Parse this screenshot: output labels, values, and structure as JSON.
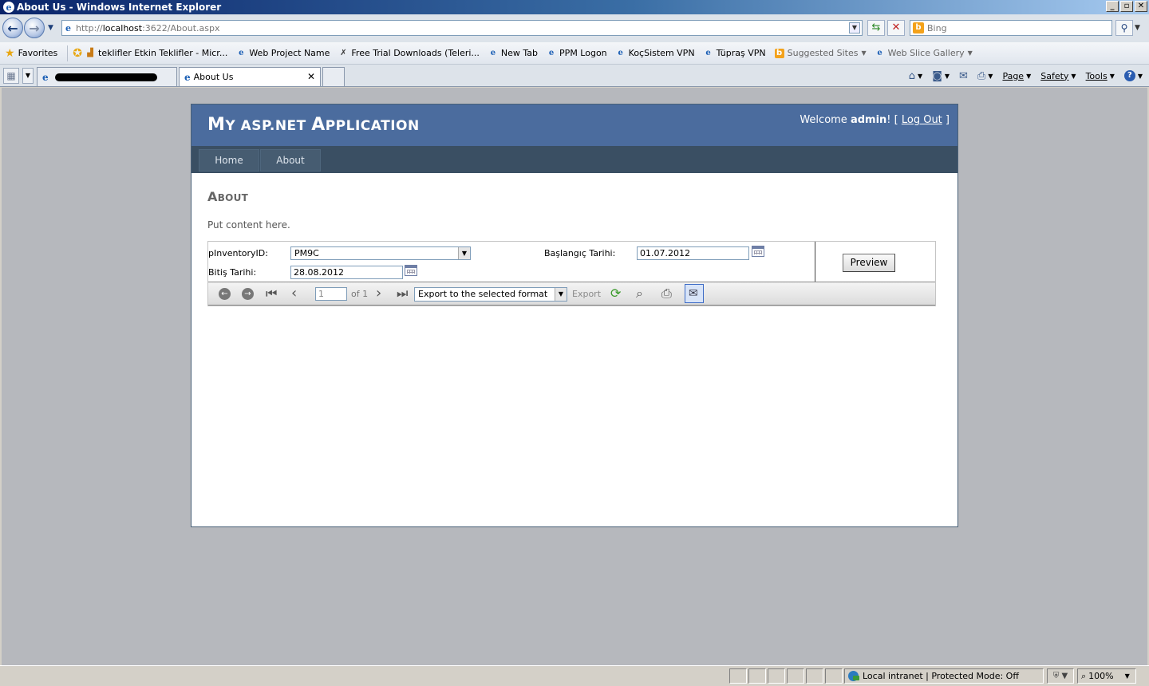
{
  "window": {
    "title": "About Us - Windows Internet Explorer",
    "minimize": "_",
    "maximize": "▫",
    "close": "✕"
  },
  "address": {
    "url_prefix": "http://",
    "url_host": "localhost",
    "url_rest": ":3622/About.aspx",
    "search_placeholder": "Bing"
  },
  "favorites": {
    "label": "Favorites",
    "items": [
      {
        "label": "teklifler Etkin Teklifler - Micr...",
        "icon": "chart-icon"
      },
      {
        "label": "Web Project Name",
        "icon": "ie-page-icon"
      },
      {
        "label": "Free Trial Downloads (Teleri...",
        "icon": "tool-icon"
      },
      {
        "label": "New Tab",
        "icon": "ie-page-icon"
      },
      {
        "label": "PPM Logon",
        "icon": "ie-page-icon"
      },
      {
        "label": "KoçSistem VPN",
        "icon": "ie-page-icon"
      },
      {
        "label": "Tüpraş VPN",
        "icon": "ie-page-icon"
      },
      {
        "label": "Suggested Sites",
        "icon": "bing-icon"
      },
      {
        "label": "Web Slice Gallery",
        "icon": "ie-page-icon"
      }
    ]
  },
  "tabs": {
    "active_label": "About Us"
  },
  "commandbar": {
    "page": "Page",
    "safety": "Safety",
    "tools": "Tools",
    "help": "?"
  },
  "site": {
    "title_initial": "M",
    "title_rest": "Y ASP.NET ",
    "title_initial2": "A",
    "title_rest2": "PPLICATION",
    "welcome": "Welcome ",
    "user": "admin",
    "bracket_open": "! [ ",
    "logout": "Log Out",
    "bracket_close": " ]",
    "menu": [
      "Home",
      "About"
    ],
    "heading_initial": "A",
    "heading_rest": "BOUT",
    "content": "Put content here."
  },
  "report": {
    "param1_label": "pInventoryID:",
    "param1_value": "PM9C",
    "param2_label": "Başlangıç Tarihi:",
    "param2_value": "01.07.2012",
    "param3_label": "Bitiş Tarihi:",
    "param3_value": "28.08.2012",
    "preview": "Preview",
    "page_number": "1",
    "page_of": "of 1",
    "export_format": "Export to the selected format",
    "export_link": "Export"
  },
  "status": {
    "zone": "Local intranet | Protected Mode: Off",
    "zoom": "100%"
  }
}
